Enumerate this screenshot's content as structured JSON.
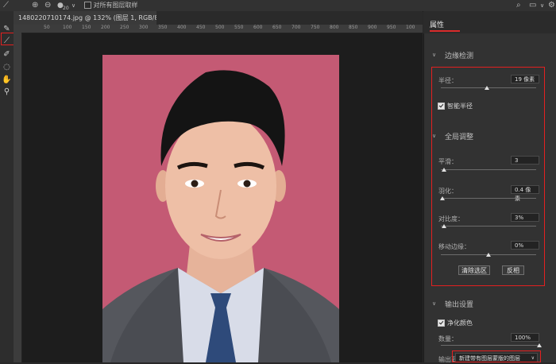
{
  "option_bar": {
    "sample_all_layers_label": "对所有图层取样",
    "brush_size_value": "20"
  },
  "document": {
    "tab_title": "1480220710174.jpg @ 132% (图层 1, RGB/8#) *",
    "close_glyph": "×",
    "ruler_numbers": [
      "50",
      "100",
      "150",
      "200",
      "250",
      "300",
      "350",
      "400",
      "450",
      "500",
      "550",
      "600",
      "650",
      "700",
      "750",
      "800",
      "850",
      "900",
      "950",
      "100"
    ]
  },
  "panel": {
    "title": "属性",
    "edge_detection": {
      "heading": "边缘检测",
      "radius_label": "半径：",
      "radius_value": "19 像素",
      "radius_fraction": 0.48,
      "smart_radius_label": "智能半径",
      "smart_radius_checked": true
    },
    "global_refine": {
      "heading": "全局调整",
      "smooth_label": "平滑：",
      "smooth_value": "3",
      "smooth_fraction": 0.03,
      "feather_label": "羽化：",
      "feather_value": "0.4 像素",
      "feather_fraction": 0.02,
      "contrast_label": "对比度：",
      "contrast_value": "3%",
      "contrast_fraction": 0.03,
      "shift_edge_label": "移动边缘：",
      "shift_edge_value": "0%",
      "shift_edge_fraction": 0.5,
      "clear_selection_label": "清除选区",
      "invert_label": "反相"
    },
    "output_settings": {
      "heading": "输出设置",
      "decontaminate_label": "净化颜色",
      "decontaminate_checked": true,
      "amount_label": "数量：",
      "amount_value": "100%",
      "amount_fraction": 1.0,
      "output_to_label": "输出到：",
      "output_to_value": "新建带有图层蒙版的图层"
    }
  },
  "colors": {
    "photo_background": "#c45a74",
    "highlight_red": "#e32020",
    "workspace": "#282828"
  },
  "icons": [
    "brush-tool-icon",
    "refine-edge-brush-icon",
    "quick-selection-icon",
    "lasso-icon",
    "hand-icon",
    "zoom-icon",
    "search-icon",
    "window-icon",
    "settings-icon"
  ]
}
